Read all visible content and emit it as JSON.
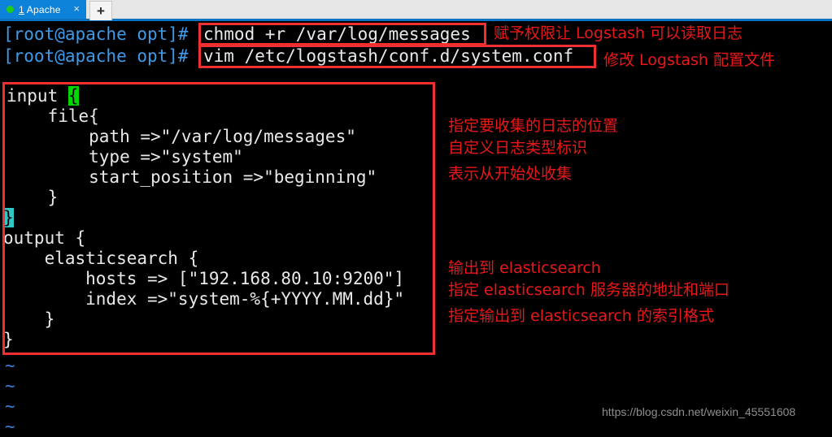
{
  "window": {
    "tab": {
      "number": "1",
      "title": " Apache",
      "close_label": "×",
      "new_tab_label": "+",
      "status_color": "#1ecc1e",
      "active_color": "#0c82d8"
    }
  },
  "terminal": {
    "prompt": "[root@apache opt]#",
    "commands": [
      "chmod +r /var/log/messages",
      "vim /etc/logstash/conf.d/system.conf"
    ],
    "prompt_color": "#3d9be9",
    "text_color": "#e9e9e9"
  },
  "editor": {
    "lines": [
      {
        "pre": "input ",
        "hl": "{",
        "hl_kind": "green",
        "post": ""
      },
      {
        "pre": "    file{",
        "hl": "",
        "hl_kind": "",
        "post": ""
      },
      {
        "pre": "        path =>\"/var/log/messages\"",
        "hl": "",
        "hl_kind": "",
        "post": ""
      },
      {
        "pre": "        type =>\"system\"",
        "hl": "",
        "hl_kind": "",
        "post": ""
      },
      {
        "pre": "        start_position =>\"beginning\"",
        "hl": "",
        "hl_kind": "",
        "post": ""
      },
      {
        "pre": "    }",
        "hl": "",
        "hl_kind": "",
        "post": ""
      },
      {
        "pre": "",
        "hl": "}",
        "hl_kind": "cyan",
        "post": ""
      },
      {
        "pre": "output {",
        "hl": "",
        "hl_kind": "",
        "post": ""
      },
      {
        "pre": "    elasticsearch {",
        "hl": "",
        "hl_kind": "",
        "post": ""
      },
      {
        "pre": "        hosts => [\"192.168.80.10:9200\"]",
        "hl": "",
        "hl_kind": "",
        "post": ""
      },
      {
        "pre": "        index =>\"system-%{+YYYY.MM.dd}\"",
        "hl": "",
        "hl_kind": "",
        "post": ""
      },
      {
        "pre": "    }",
        "hl": "",
        "hl_kind": "",
        "post": ""
      },
      {
        "pre": "}",
        "hl": "",
        "hl_kind": "",
        "post": ""
      }
    ],
    "empty_line_marker": "~",
    "empty_line_count": 4,
    "cursor_color": "#2fc7c7",
    "matching_brace_color": "#00d700"
  },
  "annotations": {
    "highlight_color": "#f03030",
    "text_color": "#e81818",
    "command_notes": [
      "赋予权限让 Logstash 可以读取日志",
      "修改 Logstash 配置文件"
    ],
    "input_notes": [
      "指定要收集的日志的位置",
      "自定义日志类型标识",
      "表示从开始处收集"
    ],
    "output_notes": [
      "输出到 elasticsearch",
      "指定 elasticsearch 服务器的地址和端口",
      "指定输出到 elasticsearch 的索引格式"
    ]
  },
  "watermark": {
    "text": "https://blog.csdn.net/weixin_45551608"
  }
}
